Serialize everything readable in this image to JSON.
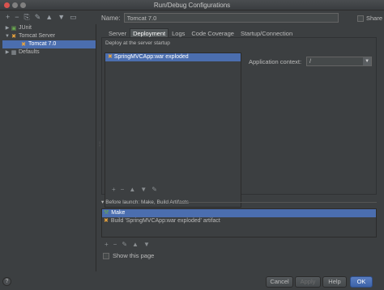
{
  "window": {
    "title": "Run/Debug Configurations"
  },
  "toolbar": {
    "icons": [
      "add-icon",
      "remove-icon",
      "copy-icon",
      "wrench-icon",
      "move-up-icon",
      "move-down-icon",
      "folder-icon"
    ],
    "glyphs": [
      "+",
      "−",
      "⎘",
      "✎",
      "▲",
      "▼",
      "▭"
    ]
  },
  "tree": {
    "items": [
      {
        "label": "JUnit",
        "level": 0,
        "arrow": "▶",
        "icon": "junit-icon",
        "glyph": "▣"
      },
      {
        "label": "Tomcat Server",
        "level": 0,
        "arrow": "▼",
        "icon": "tomcat-icon",
        "glyph": "✖"
      },
      {
        "label": "Tomcat 7.0",
        "level": 1,
        "arrow": "",
        "icon": "tomcat-icon",
        "glyph": "✖",
        "selected": true
      },
      {
        "label": "Defaults",
        "level": 0,
        "arrow": "▶",
        "icon": "defaults-icon",
        "glyph": "▦"
      }
    ]
  },
  "config": {
    "name_label": "Name:",
    "name_value": "Tomcat 7.0",
    "share_label": "Share"
  },
  "tabs": [
    {
      "label": "Server",
      "active": false
    },
    {
      "label": "Deployment",
      "active": true
    },
    {
      "label": "Logs",
      "active": false
    },
    {
      "label": "Code Coverage",
      "active": false
    },
    {
      "label": "Startup/Connection",
      "active": false
    }
  ],
  "deployment": {
    "caption": "Deploy at the server startup",
    "artifact": "SpringMVCApp:war exploded",
    "context_label": "Application context:",
    "context_value": "/",
    "list_tools": [
      "+",
      "−",
      "▲",
      "▼",
      "✎"
    ]
  },
  "before_launch": {
    "title": "Before launch: Make, Build Artifacts",
    "items": [
      {
        "label": "Make",
        "selected": true,
        "icon": "make-icon"
      },
      {
        "label": "Build 'SpringMVCApp:war exploded' artifact",
        "selected": false,
        "icon": "build-artifact-icon"
      }
    ],
    "tools": [
      "+",
      "−",
      "✎",
      "▲",
      "▼"
    ]
  },
  "show_page_label": "Show this page",
  "buttons": {
    "help_glyph": "?",
    "cancel": "Cancel",
    "apply": "Apply",
    "help": "Help",
    "ok": "OK"
  },
  "colors": {
    "background": "#3c3f41",
    "selection": "#4b6eaf",
    "text": "#bbbbbb"
  }
}
